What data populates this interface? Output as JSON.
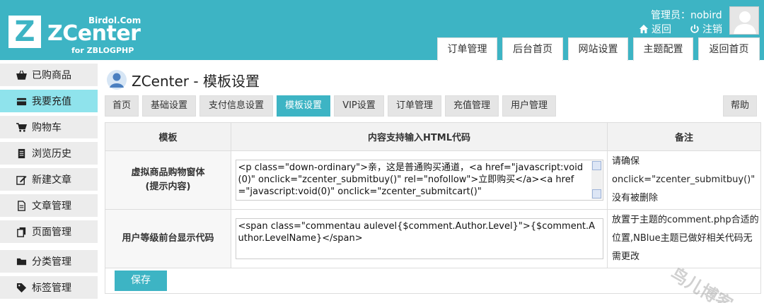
{
  "header": {
    "logo_letter": "Z",
    "brand_site": "Birdol.Com",
    "brand_name": "ZCenter",
    "brand_sub": "for ZBLOGPHP",
    "admin_label": "管理员：nobird",
    "back_label": "返回",
    "logout_label": "注销",
    "tabs": [
      "订单管理",
      "后台首页",
      "网站设置",
      "主题配置",
      "返回首页"
    ]
  },
  "sidebar": {
    "items": [
      {
        "label": "已购商品",
        "icon": "basket-icon"
      },
      {
        "label": "我要充值",
        "icon": "card-icon"
      },
      {
        "label": "购物车",
        "icon": "cart-icon"
      },
      {
        "label": "浏览历史",
        "icon": "history-icon"
      },
      {
        "label": "新建文章",
        "icon": "edit-icon"
      },
      {
        "label": "文章管理",
        "icon": "document-icon"
      },
      {
        "label": "页面管理",
        "icon": "pages-icon"
      },
      {
        "label": "分类管理",
        "icon": "folder-icon"
      },
      {
        "label": "标签管理",
        "icon": "tag-icon"
      }
    ],
    "active_index": 1
  },
  "main": {
    "page_title": "ZCenter - 模板设置",
    "tabs": [
      "首页",
      "基础设置",
      "支付信息设置",
      "模板设置",
      "VIP设置",
      "订单管理",
      "充值管理",
      "用户管理"
    ],
    "active_tab": "模板设置",
    "help_label": "帮助",
    "table": {
      "headers": [
        "模板",
        "内容支持输入HTML代码",
        "备注"
      ],
      "rows": [
        {
          "label_line1": "虚拟商品购物窗体",
          "label_line2": "(提示内容)",
          "code": "<p class=\"down-ordinary\">亲，这是普通购买通道，<a href=\"javascript:void(0)\"  onclick=\"zcenter_submitbuy()\" rel=\"nofollow\">立即购买</a><a href=\"javascript:void(0)\"  onclick=\"zcenter_submitcart()\"",
          "note_line1": "请确保",
          "note_line2": "onclick=\"zcenter_submitbuy()\"",
          "note_line3": "没有被删除"
        },
        {
          "label": "用户等级前台显示代码",
          "code": "<span class=\"commentau aulevel{$comment.Author.Level}\">{$comment.Author.LevelName}</span>",
          "note": "放置于主题的comment.php合适的位置,NBlue主题已做好相关代码无需更改"
        }
      ]
    },
    "save_label": "保存"
  },
  "watermark": "鸟儿博客",
  "colors": {
    "accent": "#3db4c4",
    "sidebar_active": "#8fe3ec",
    "sidebar_bg": "#ececec"
  }
}
